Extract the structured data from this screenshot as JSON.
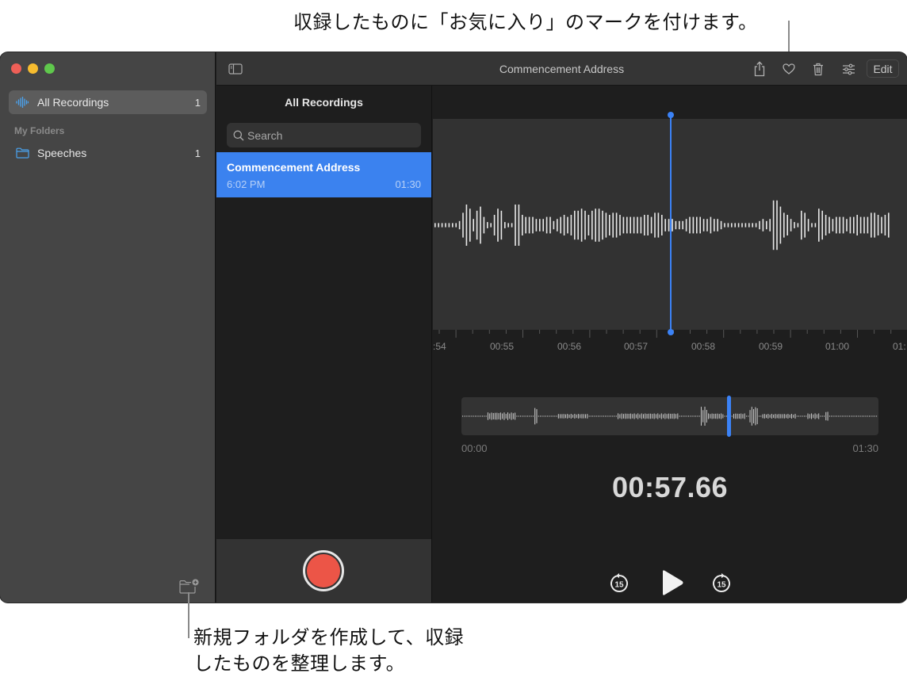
{
  "annotations": {
    "top": "収録したものに「お気に入り」のマークを付けます。",
    "bottom_line1": "新規フォルダを作成して、収録",
    "bottom_line2": "したものを整理します。"
  },
  "sidebar": {
    "items": [
      {
        "label": "All Recordings",
        "count": "1",
        "icon": "waveform-icon",
        "selected": true
      }
    ],
    "folders_heading": "My Folders",
    "folders": [
      {
        "label": "Speeches",
        "count": "1",
        "icon": "folder-icon"
      }
    ],
    "new_folder_icon": "new-folder-icon"
  },
  "toolbar": {
    "title": "Commencement Address",
    "sidebar_toggle_icon": "sidebar-toggle-icon",
    "share_icon": "share-icon",
    "favorite_icon": "heart-icon",
    "delete_icon": "trash-icon",
    "settings_icon": "sliders-icon",
    "edit_label": "Edit"
  },
  "list": {
    "title": "All Recordings",
    "search_placeholder": "Search",
    "recordings": [
      {
        "name": "Commencement Address",
        "time": "6:02 PM",
        "duration": "01:30",
        "selected": true
      }
    ]
  },
  "player": {
    "ruler_labels": [
      ":54",
      "00:55",
      "00:56",
      "00:57",
      "00:58",
      "00:59",
      "01:00",
      "01:"
    ],
    "overview_start": "00:00",
    "overview_end": "01:30",
    "position_fraction": 0.6407,
    "elapsed": "00:57.66",
    "skip_back_label": "15",
    "skip_forward_label": "15",
    "accent_color": "#3b82f6",
    "record_color": "#ec5547"
  }
}
